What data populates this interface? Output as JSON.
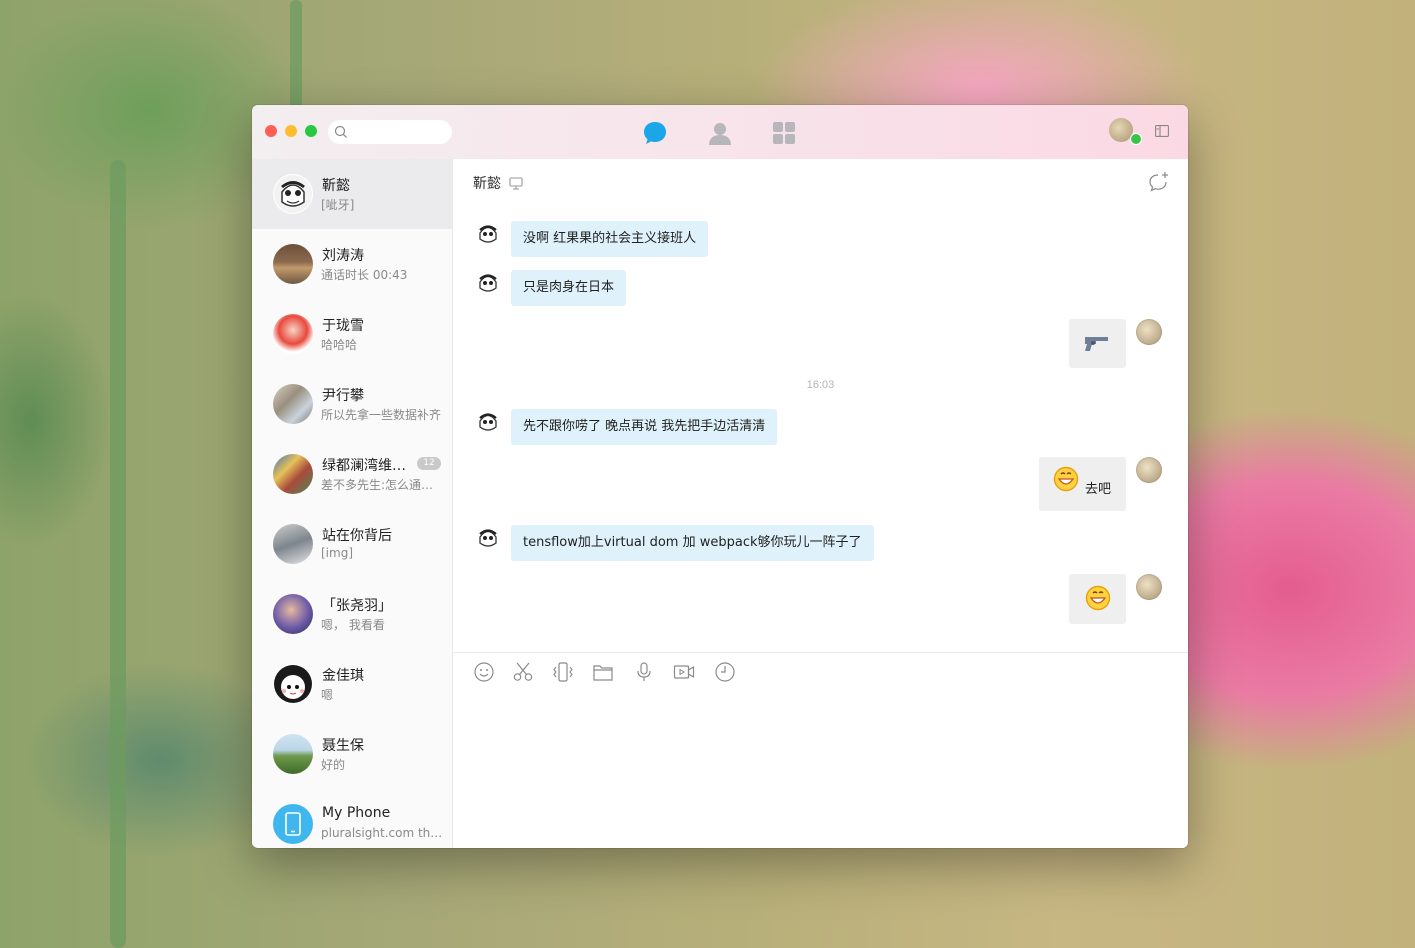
{
  "search": {
    "placeholder": ""
  },
  "nav": {
    "tabs": [
      "chats",
      "contacts",
      "apps"
    ]
  },
  "conversations": [
    {
      "name": "靳懿",
      "preview": "[呲牙]",
      "active": true
    },
    {
      "name": "刘涛涛",
      "preview": "通话时长 00:43"
    },
    {
      "name": "于珑雪",
      "preview": "哈哈哈"
    },
    {
      "name": "尹行攀",
      "preview": "所以先拿一些数据补齐"
    },
    {
      "name": "绿都澜湾维…",
      "preview": "差不多先生:怎么通知…",
      "badge": "12"
    },
    {
      "name": "站在你背后",
      "preview": "[img]"
    },
    {
      "name": "「张尧羽」",
      "preview": "嗯， 我看看"
    },
    {
      "name": "金佳琪",
      "preview": "嗯"
    },
    {
      "name": "聂生保",
      "preview": "好的"
    },
    {
      "name": "My Phone",
      "preview": "pluralsight.com   thi…"
    }
  ],
  "chat": {
    "title": "靳懿",
    "messages": [
      {
        "from": "them",
        "text": "没啊 红果果的社会主义接班人"
      },
      {
        "from": "them",
        "text": "只是肉身在日本"
      },
      {
        "from": "me",
        "emoji": "pistol"
      },
      {
        "from": "them",
        "text": "先不跟你唠了  晚点再说 我先把手边活清清"
      },
      {
        "from": "me",
        "emoji": "grin",
        "text": "去吧"
      },
      {
        "from": "them",
        "text": "tensflow加上virtual dom 加 webpack够你玩儿一阵子了"
      },
      {
        "from": "me",
        "emoji": "grin"
      }
    ],
    "timestamp": "16:03"
  },
  "toolbar": [
    "emoji-icon",
    "scissors-icon",
    "shake-icon",
    "folder-icon",
    "mic-icon",
    "video-icon",
    "history-icon"
  ],
  "colors": {
    "accent": "#1296db",
    "bubble_in": "#dff2fb",
    "bubble_out": "#efefef"
  }
}
